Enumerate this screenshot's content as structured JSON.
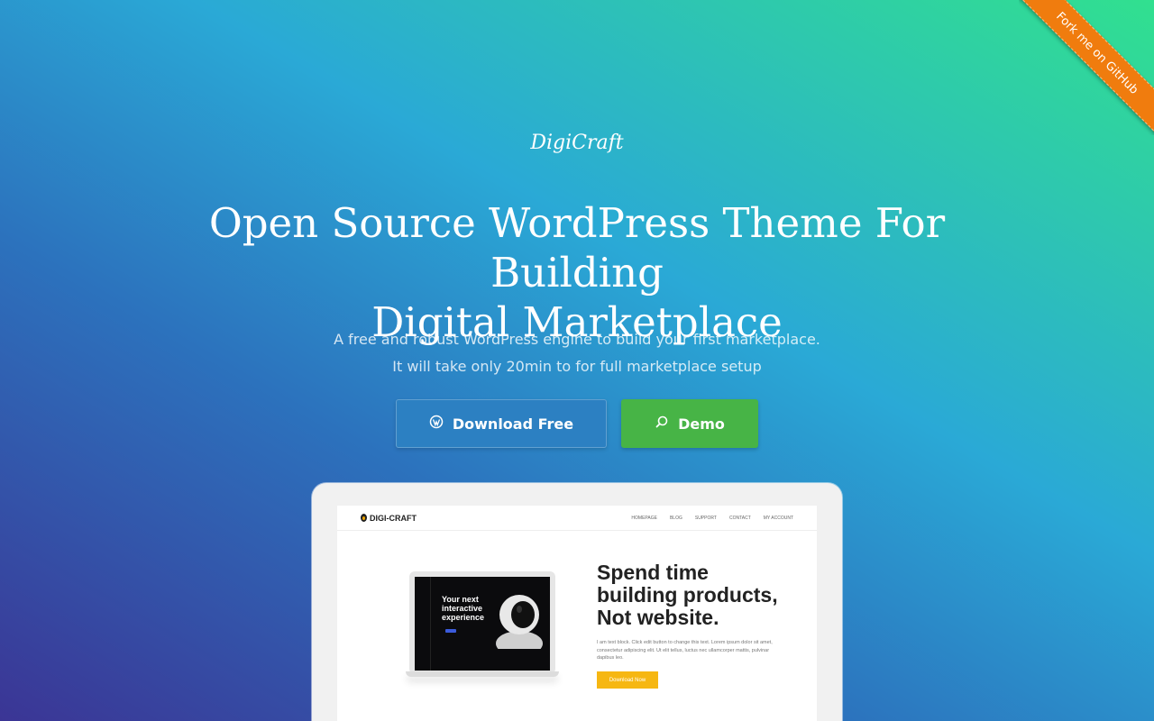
{
  "ribbon": {
    "label": "Fork me on GitHub"
  },
  "brand": "DigiCraft",
  "headline": {
    "line1": "Open Source WordPress Theme For Building",
    "line2": "Digital Marketplace"
  },
  "subtitle": {
    "line1": "A free and robust WordPress engine to build your first marketplace.",
    "line2": "It will take only 20min to for full marketplace setup"
  },
  "buttons": {
    "download": {
      "label": "Download Free",
      "icon": "wordpress-icon"
    },
    "demo": {
      "label": "Demo",
      "icon": "search-icon"
    }
  },
  "preview": {
    "logo": "DIGI-CRAFT",
    "menu": [
      "HOMEPAGE",
      "BLOG",
      "SUPPORT",
      "CONTACT",
      "MY ACCOUNT"
    ],
    "mini_title": {
      "line1": "Your next",
      "line2": "interactive",
      "line3": "experience"
    },
    "tagline": {
      "line1": "Spend time",
      "line2": "building products,",
      "line3": "Not website."
    },
    "body": "I am text block. Click edit button to change this text. Lorem ipsum dolor sit amet, consectetur adipiscing elit. Ut elit tellus, luctus nec ullamcorper mattis, pulvinar dapibus leo.",
    "cta": "Download Now"
  },
  "colors": {
    "ribbon": "#f07c0e",
    "download": "#2c80c2",
    "demo": "#47b446",
    "cta": "#f6b712"
  }
}
